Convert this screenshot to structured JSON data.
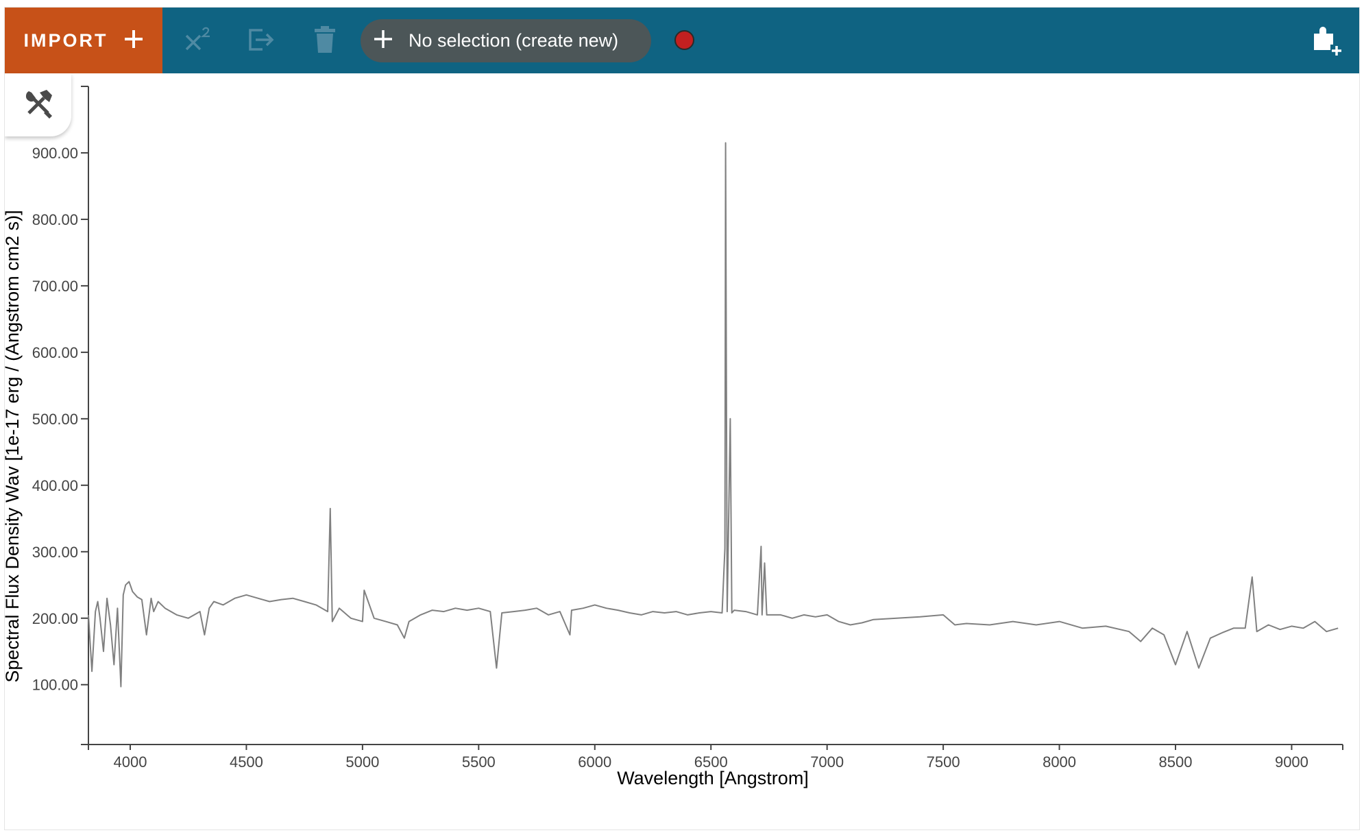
{
  "toolbar": {
    "import_label": "IMPORT",
    "subset_label": "No selection (create new)",
    "icons": {
      "import": "plus-icon",
      "model_fit": "x-squared-icon",
      "export": "export-icon",
      "delete": "trash-icon",
      "subset_add": "plus-icon",
      "record": "record-dot-icon",
      "plugin": "plugin-add-icon"
    },
    "colors": {
      "bar": "#0f6382",
      "import": "#c75118",
      "pill": "#4c5658",
      "record": "#c32020"
    }
  },
  "tools_tab": {
    "icon": "hammer-wrench-icon"
  },
  "chart_data": {
    "type": "line",
    "xlabel": "Wavelength [Angstrom]",
    "ylabel": "Spectral Flux Density Wav [1e-17 erg / (Angstrom cm2 s)]",
    "xlim": [
      3820,
      9220
    ],
    "ylim": [
      10,
      1000
    ],
    "x_ticks": [
      4000,
      4500,
      5000,
      5500,
      6000,
      6500,
      7000,
      7500,
      8000,
      8500,
      9000
    ],
    "x_tick_labels": [
      "4000",
      "4500",
      "5000",
      "5500",
      "6000",
      "6500",
      "7000",
      "7500",
      "8000",
      "8500",
      "9000"
    ],
    "y_ticks": [
      100,
      200,
      300,
      400,
      500,
      600,
      700,
      800,
      900
    ],
    "y_tick_labels": [
      "100.00",
      "200.00",
      "300.00",
      "400.00",
      "500.00",
      "600.00",
      "700.00",
      "800.00",
      "900.00"
    ],
    "line_color": "#808080",
    "grid": false,
    "series": [
      {
        "x": [
          3820,
          3835,
          3850,
          3860,
          3870,
          3885,
          3900,
          3915,
          3930,
          3945,
          3960,
          3970,
          3980,
          3995,
          4010,
          4030,
          4050,
          4070,
          4090,
          4101,
          4120,
          4150,
          4200,
          4250,
          4300,
          4320,
          4340,
          4360,
          4400,
          4450,
          4500,
          4550,
          4600,
          4650,
          4700,
          4750,
          4800,
          4850,
          4861,
          4870,
          4900,
          4950,
          5000,
          5007,
          5050,
          5100,
          5150,
          5180,
          5200,
          5250,
          5300,
          5350,
          5400,
          5450,
          5500,
          5550,
          5577,
          5600,
          5650,
          5700,
          5750,
          5800,
          5850,
          5893,
          5900,
          5950,
          6000,
          6050,
          6100,
          6150,
          6200,
          6250,
          6300,
          6350,
          6400,
          6450,
          6500,
          6548,
          6560,
          6563,
          6570,
          6583,
          6590,
          6600,
          6650,
          6700,
          6716,
          6720,
          6731,
          6740,
          6800,
          6850,
          6900,
          6950,
          7000,
          7050,
          7100,
          7150,
          7200,
          7300,
          7400,
          7500,
          7550,
          7600,
          7700,
          7800,
          7900,
          8000,
          8100,
          8200,
          8300,
          8350,
          8400,
          8450,
          8500,
          8550,
          8600,
          8650,
          8700,
          8750,
          8800,
          8830,
          8850,
          8900,
          8950,
          9000,
          9050,
          9100,
          9150,
          9200
        ],
        "y": [
          205,
          120,
          210,
          225,
          200,
          150,
          230,
          190,
          130,
          215,
          97,
          235,
          250,
          255,
          240,
          232,
          228,
          175,
          230,
          210,
          225,
          215,
          205,
          200,
          210,
          175,
          215,
          225,
          220,
          230,
          235,
          230,
          225,
          228,
          230,
          225,
          220,
          210,
          365,
          195,
          215,
          200,
          195,
          242,
          200,
          195,
          190,
          170,
          195,
          205,
          212,
          210,
          215,
          212,
          215,
          210,
          125,
          208,
          210,
          212,
          215,
          205,
          210,
          175,
          212,
          215,
          220,
          215,
          212,
          208,
          205,
          210,
          208,
          210,
          205,
          208,
          210,
          208,
          305,
          915,
          210,
          500,
          208,
          212,
          210,
          205,
          308,
          205,
          283,
          205,
          205,
          200,
          205,
          202,
          205,
          195,
          190,
          193,
          198,
          200,
          202,
          205,
          190,
          192,
          190,
          195,
          190,
          195,
          185,
          188,
          180,
          165,
          185,
          175,
          130,
          180,
          125,
          170,
          178,
          185,
          185,
          262,
          180,
          190,
          183,
          188,
          185,
          195,
          180,
          185
        ]
      }
    ]
  }
}
